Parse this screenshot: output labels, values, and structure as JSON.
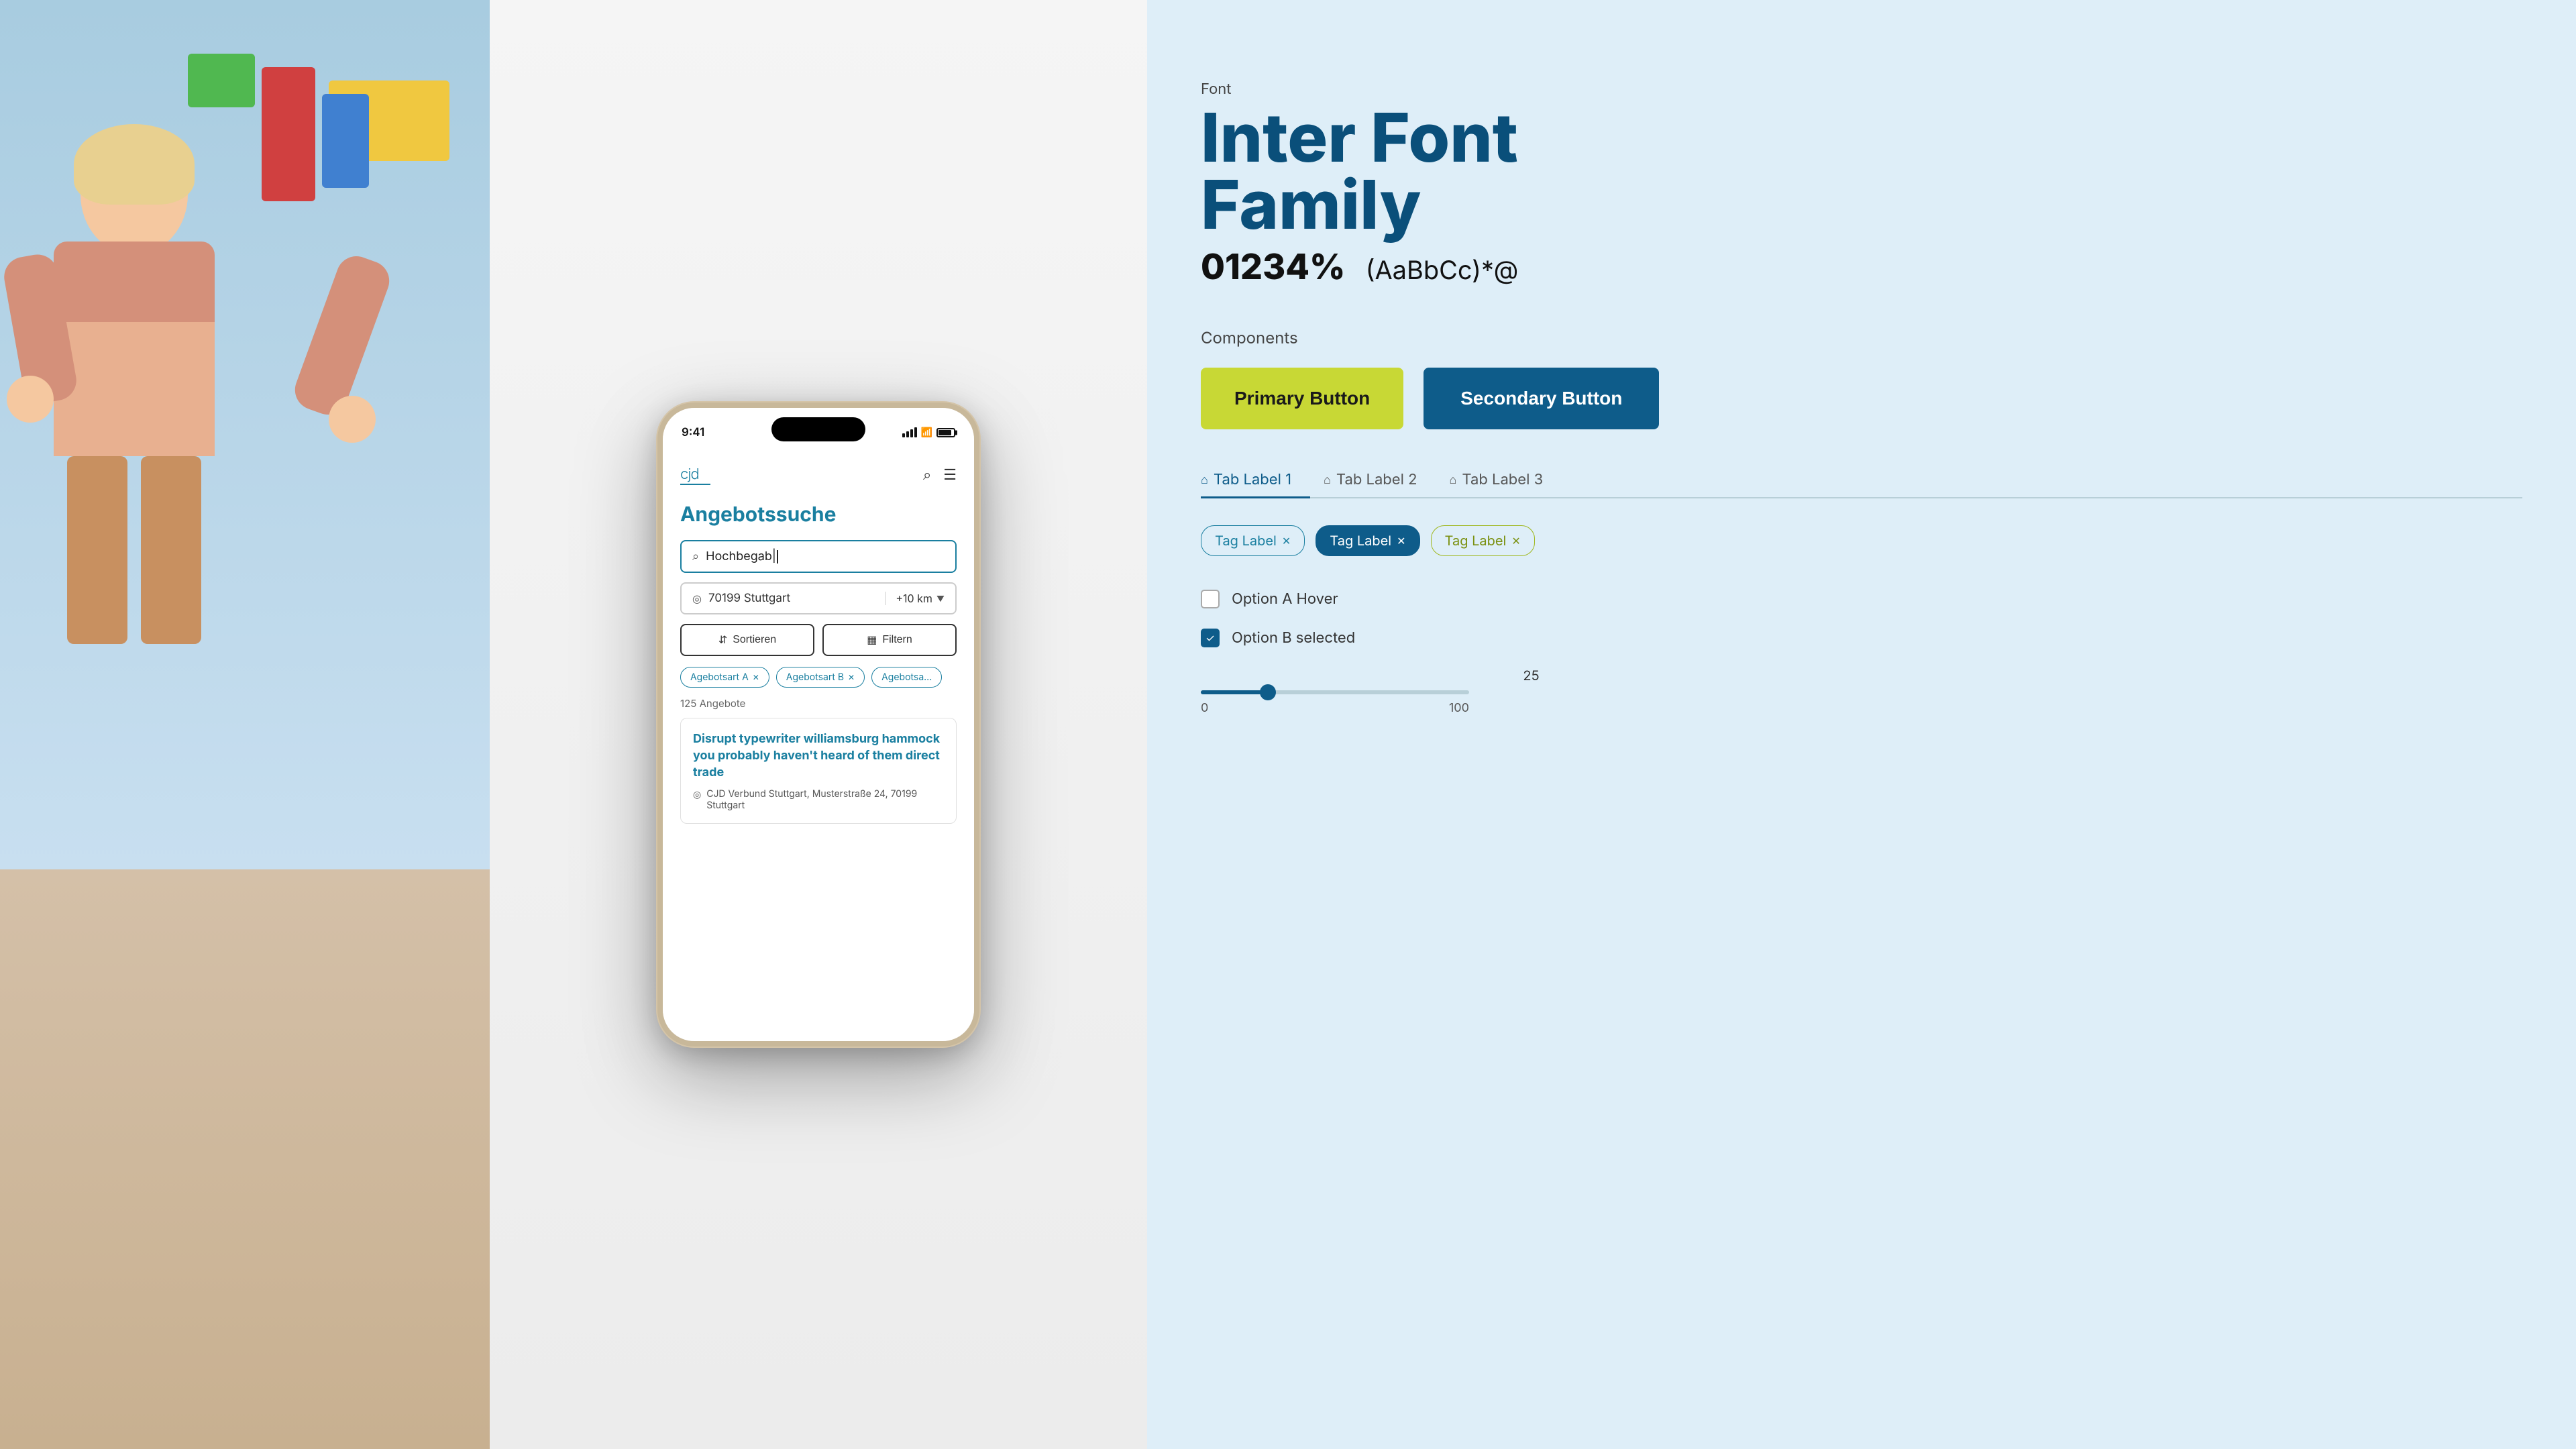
{
  "photo": {
    "alt": "Child in classroom"
  },
  "phone": {
    "status_bar": {
      "time": "9:41",
      "signal_alt": "signal bars",
      "wifi_alt": "wifi",
      "battery_alt": "battery"
    },
    "header": {
      "logo": "cjd",
      "search_icon": "search",
      "menu_icon": "menu"
    },
    "page_title": "Angebotssuche",
    "search": {
      "placeholder": "Hochbegab|",
      "value": "Hochbegab|"
    },
    "location": {
      "value": "70199 Stuttgart",
      "km_label": "+10 km"
    },
    "buttons": {
      "sort_label": "Sortieren",
      "filter_label": "Filtern"
    },
    "tags": [
      {
        "label": "Agebotsart A",
        "removable": true
      },
      {
        "label": "Agebotsart B",
        "removable": true
      },
      {
        "label": "Agebotsa…",
        "removable": false
      }
    ],
    "results_count": "125 Angebote",
    "result_card": {
      "title": "Disrupt typewriter williamsburg hammock you probably haven't heard of them direct trade",
      "location": "CJD Verbund Stuttgart, Musterstraße 24, 70199 Stuttgart"
    }
  },
  "design_panel": {
    "font_section": {
      "label": "Font",
      "title_line1": "Inter Font",
      "title_line2": "Family",
      "numbers": "01234%",
      "chars": "(AaBbCc)*@"
    },
    "components_section": {
      "label": "Components",
      "primary_button": "Primary Button",
      "secondary_button": "Secondary Button"
    },
    "tabs": [
      {
        "label": "Tab Label 1",
        "active": true
      },
      {
        "label": "Tab Label 2",
        "active": false
      },
      {
        "label": "Tab Label 3",
        "active": false
      }
    ],
    "tag_labels": [
      {
        "label": "Tag Label",
        "style": "outline"
      },
      {
        "label": "Tag Label",
        "style": "dark"
      },
      {
        "label": "Tag Label",
        "style": "green"
      }
    ],
    "checkboxes": [
      {
        "label": "Option A Hover",
        "checked": false
      },
      {
        "label": "Option B selected",
        "checked": true
      }
    ],
    "slider": {
      "value": 25,
      "min": 0,
      "max": 100,
      "min_label": "0",
      "max_label": "100"
    }
  }
}
